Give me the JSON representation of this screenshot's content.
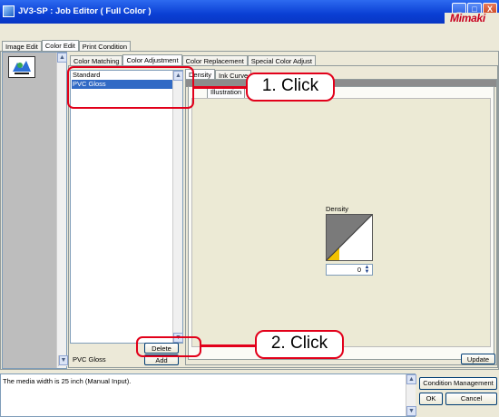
{
  "window": {
    "title": "JV3-SP : Job Editor ( Full Color )",
    "brand": "Mimaki",
    "controls": [
      "_",
      "□",
      "X"
    ]
  },
  "main_tabs": [
    {
      "label": "Image Edit",
      "active": false
    },
    {
      "label": "Color Edit",
      "active": true
    },
    {
      "label": "Print Condition",
      "active": false
    }
  ],
  "sub_tabs": [
    {
      "label": "Color Matching",
      "active": false
    },
    {
      "label": "Color Adjustment",
      "active": true
    },
    {
      "label": "Color Replacement",
      "active": false
    },
    {
      "label": "Special Color Adjust",
      "active": false
    }
  ],
  "adjust_list": {
    "items": [
      {
        "label": "Standard",
        "selected": false
      },
      {
        "label": "PVC Gloss",
        "selected": true
      }
    ],
    "name_value": "PVC Gloss",
    "delete_label": "Delete",
    "add_label": "Add"
  },
  "right_tabs": [
    {
      "label": "Density",
      "active": true
    },
    {
      "label": "Ink Curve",
      "active": false
    }
  ],
  "inner_tabs": [
    {
      "label": "Illustration"
    }
  ],
  "density": {
    "label": "Density",
    "value": "0"
  },
  "update_label": "Update",
  "status_message": "The media width is 25 inch (Manual Input).",
  "footer": {
    "condition_management": "Condition Management",
    "ok": "OK",
    "cancel": "Cancel"
  },
  "callouts": {
    "first": "1. Click",
    "second": "2. Click"
  },
  "colors": {
    "highlight": "#e2001a",
    "selection": "#316ac5",
    "titlebar": "#0a3fd4"
  }
}
